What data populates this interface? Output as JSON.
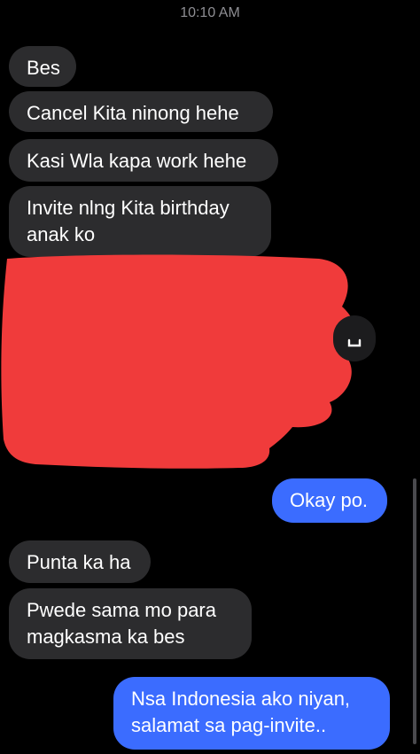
{
  "status": {
    "time": "10:10 AM"
  },
  "messages": {
    "m1": {
      "text": "Bes"
    },
    "m2": {
      "text": "Cancel Kita ninong hehe"
    },
    "m3": {
      "text": "Kasi Wla kapa work hehe"
    },
    "m4": {
      "line1": "Invite nlng Kita birthday",
      "line2": "anak ko"
    },
    "m5": {
      "text": "Okay po."
    },
    "m6": {
      "text": "Punta ka ha"
    },
    "m7": {
      "line1": "Pwede sama mo para",
      "line2": "magkasma ka bes"
    },
    "m8": {
      "line1": "Nsa Indonesia ako niyan,",
      "line2": "salamat sa pag-invite.."
    }
  },
  "colors": {
    "received_bubble": "#2c2c2e",
    "sent_bubble": "#3b6cff",
    "redaction": "#f03b3b"
  },
  "icons": {
    "reaction": "share-icon"
  }
}
